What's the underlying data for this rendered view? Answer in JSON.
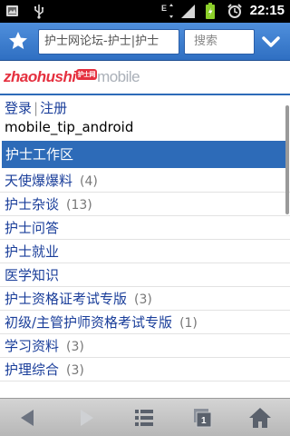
{
  "status_bar": {
    "time": "22:15",
    "icons": [
      "notification-icon",
      "usb-icon",
      "network-icon",
      "signal-icon",
      "battery-icon",
      "alarm-icon"
    ]
  },
  "toolbar": {
    "url": "护士网论坛-护士|护士",
    "search_placeholder": "搜索"
  },
  "logo": {
    "part1": "zhaohushi",
    "badge": "护士网",
    "part2": "mobile"
  },
  "login": {
    "login_label": "登录",
    "separator": "|",
    "register_label": "注册",
    "tip": "mobile_tip_android"
  },
  "section": {
    "title": "护士工作区"
  },
  "forums": [
    {
      "name": "天使爆爆料",
      "count": "(4)"
    },
    {
      "name": "护士杂谈",
      "count": "(13)"
    },
    {
      "name": "护士问答",
      "count": ""
    },
    {
      "name": "护士就业",
      "count": ""
    },
    {
      "name": "医学知识",
      "count": ""
    },
    {
      "name": "护士资格证考试专版",
      "count": "(3)"
    },
    {
      "name": "初级/主管护师资格考试专版",
      "count": "(1)"
    },
    {
      "name": "学习资料",
      "count": "(3)"
    },
    {
      "name": "护理综合",
      "count": "(3)"
    }
  ],
  "colors": {
    "toolbar": "#3f7fd0",
    "section_header": "#2d6bb8",
    "link": "#1a3e9a",
    "logo_red": "#e5303f"
  }
}
